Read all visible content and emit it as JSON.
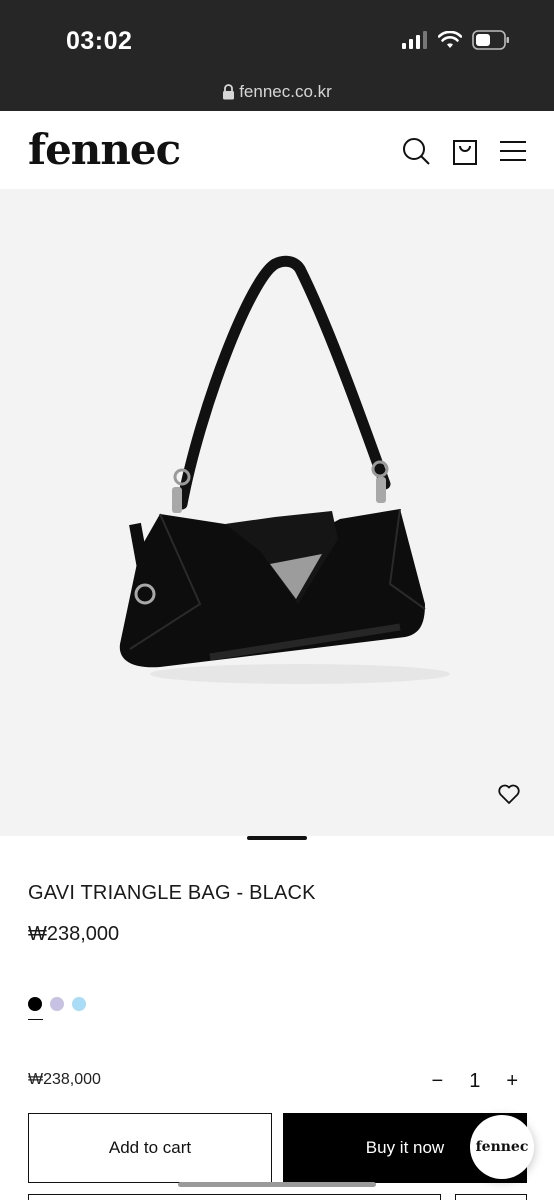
{
  "status_bar": {
    "time": "03:02"
  },
  "browser": {
    "url": "fennec.co.kr"
  },
  "site": {
    "logo": "fennec"
  },
  "product": {
    "title": "GAVI TRIANGLE BAG - BLACK",
    "price": "₩238,000",
    "colors": [
      "#000000",
      "#c7c2e3",
      "#a9dcf7"
    ],
    "selected_color_index": 0
  },
  "purchase": {
    "subtotal": "₩238,000",
    "quantity": "1",
    "minus": "−",
    "plus": "+",
    "add_to_cart": "Add to cart",
    "buy_now": "Buy it now"
  },
  "chat": {
    "label": "fennec"
  }
}
